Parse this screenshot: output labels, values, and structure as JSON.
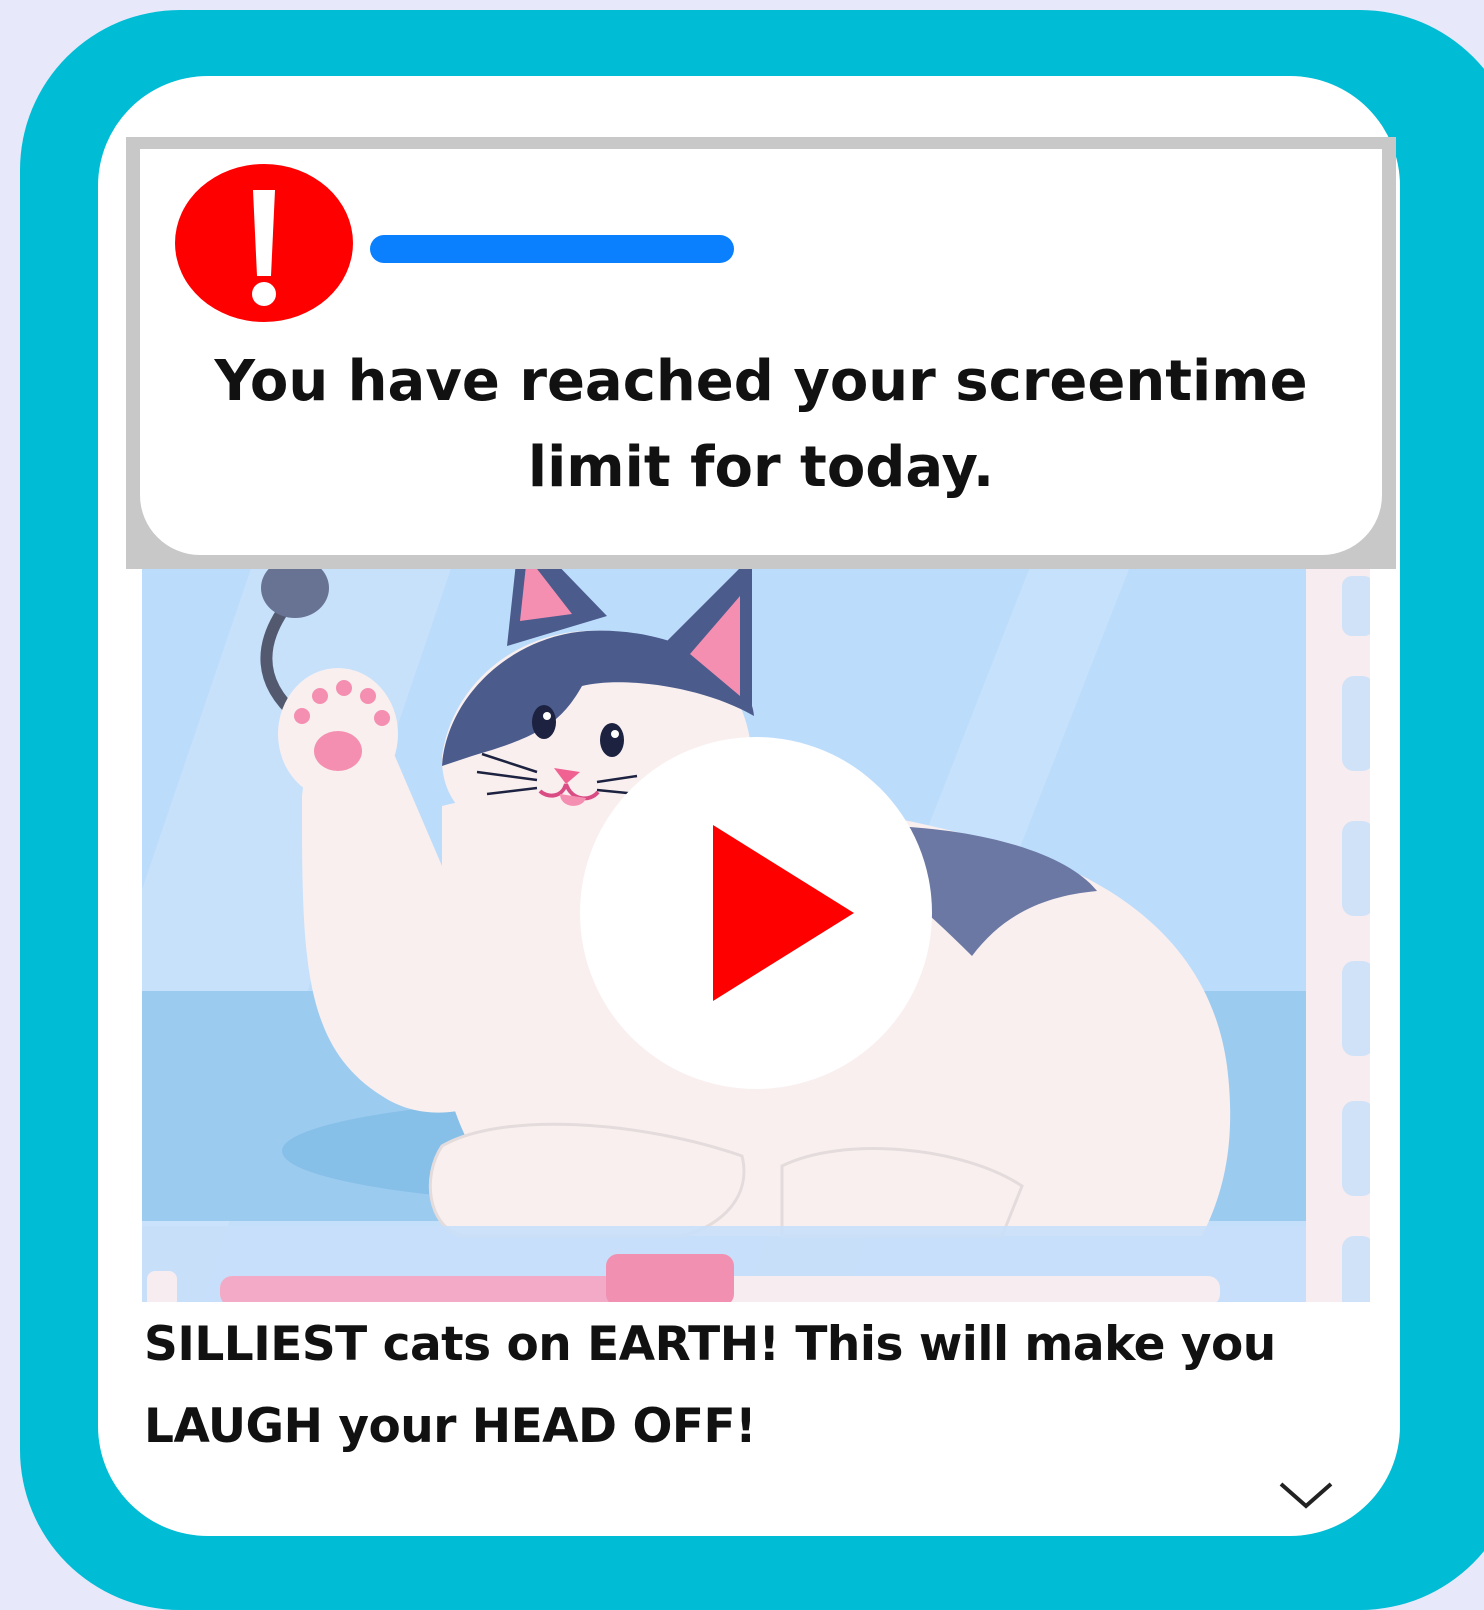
{
  "alert": {
    "icon": "exclamation-icon",
    "message": "You have reached your screentime limit for today."
  },
  "video": {
    "title": "SILLIEST cats on EARTH! This will make you LAUGH your HEAD OFF!",
    "play_icon": "play-icon",
    "progress": 0.45
  },
  "colors": {
    "frame": "#00bcd4",
    "alert_red": "#ff0000",
    "alert_bar_blue": "#0a80ff",
    "play_red": "#ff0000",
    "scrubber_pink": "#f190b0"
  }
}
